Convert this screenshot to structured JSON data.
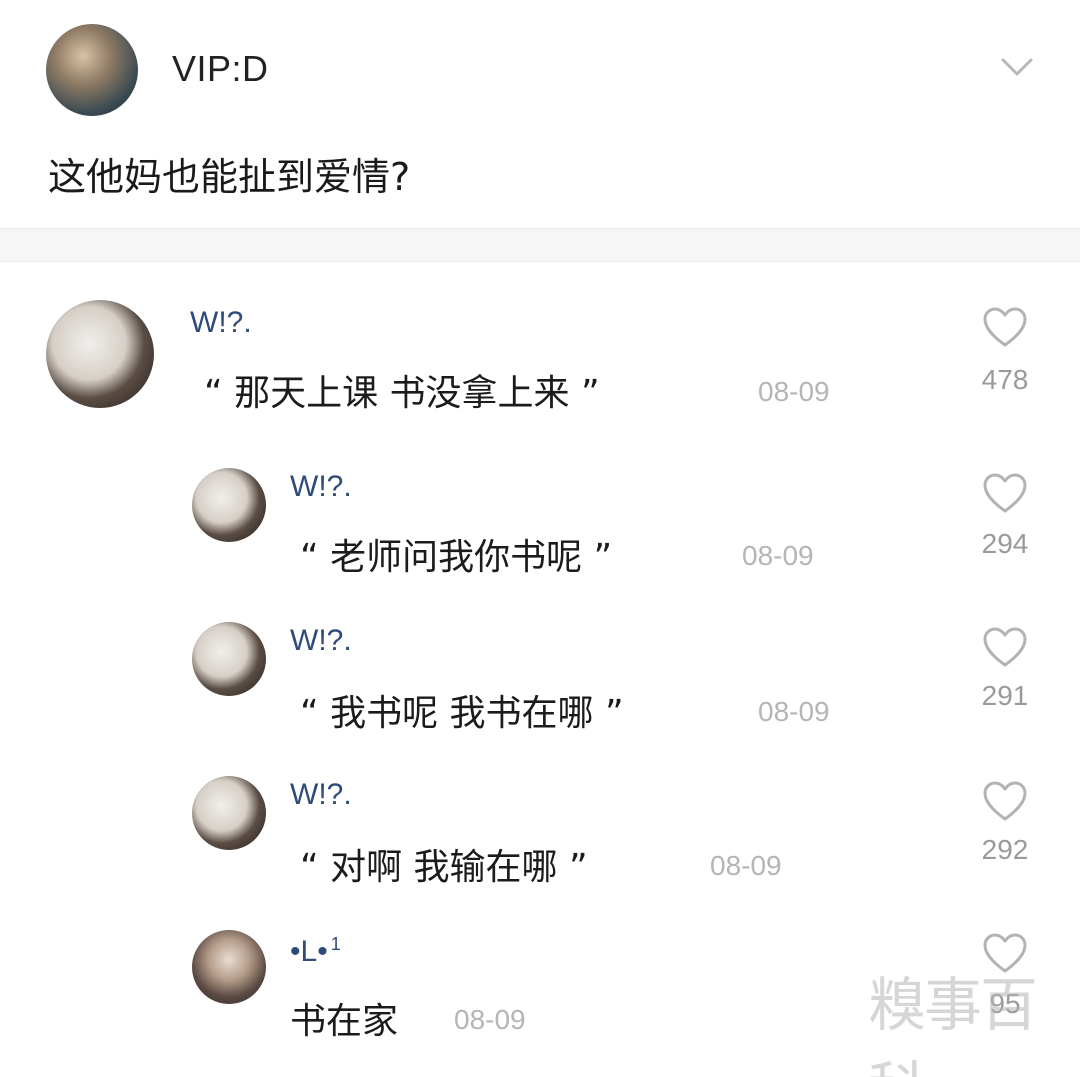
{
  "post": {
    "author": "VIP:D",
    "text": "这他妈也能扯到爱情?"
  },
  "icons": {
    "expand": "chevron-down-icon",
    "like": "heart-outline-icon"
  },
  "comments": [
    {
      "name": "W!?.",
      "text": "“ 那天上课  书没拿上来 ”",
      "date": "08-09",
      "likes": "478"
    },
    {
      "name": "W!?.",
      "text": "“ 老师问我你书呢 ”",
      "date": "08-09",
      "likes": "294"
    },
    {
      "name": "W!?.",
      "text": "“ 我书呢  我书在哪 ”",
      "date": "08-09",
      "likes": "291"
    },
    {
      "name": "W!?.",
      "text": "“ 对啊  我输在哪 ”",
      "date": "08-09",
      "likes": "292"
    },
    {
      "name": "•L•",
      "badge": "1",
      "text": "书在家",
      "date": "08-09",
      "likes": "95"
    }
  ],
  "watermark": "糗事百科"
}
